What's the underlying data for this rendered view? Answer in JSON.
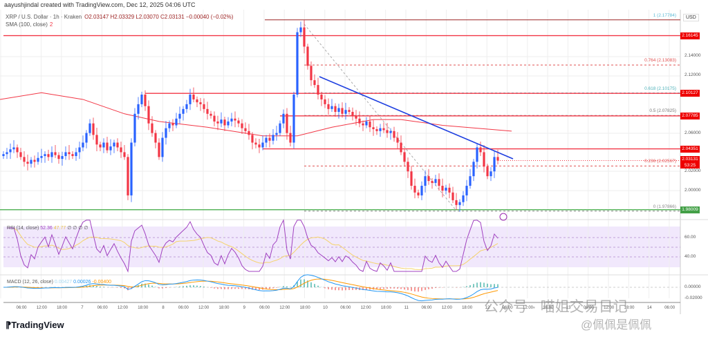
{
  "header": {
    "credit": "aayushjindal created with TradingView.com, Dec 12, 2025 04:06 UTC",
    "symbol": "XRP / U.S. Dollar · 1h · Kraken",
    "ohlc": "O2.03147  H2.03329  L2.03070  C2.03131  −0.00040 (−0.02%)",
    "sma_label": "SMA (100, close)",
    "sma_value": "2"
  },
  "axis": {
    "currency": "USD",
    "price_ticks": [
      "2.14000",
      "2.12000",
      "2.06000",
      "2.02000",
      "2.00000"
    ],
    "rsi_ticks": [
      "60.00",
      "40.00"
    ],
    "macd_ticks": [
      "0.00000",
      "-0.02000"
    ],
    "time_ticks": [
      "06:00",
      "12:00",
      "18:00",
      "7",
      "06:00",
      "12:00",
      "18:00",
      "8",
      "06:00",
      "12:00",
      "18:00",
      "9",
      "06:00",
      "12:00",
      "18:00",
      "10",
      "06:00",
      "12:00",
      "18:00",
      "11",
      "06:00",
      "12:00",
      "18:00",
      "12",
      "06:00",
      "12:00",
      "18:00",
      "13",
      "06:00",
      "12:00",
      "18:00",
      "14",
      "06:00"
    ]
  },
  "levels": [
    {
      "label": "2.16145",
      "price": 2.16145,
      "color": "#f23645"
    },
    {
      "label": "2.10127",
      "price": 2.10127,
      "color": "#f23645"
    },
    {
      "label": "2.07785",
      "price": 2.07785,
      "color": "#f23645"
    },
    {
      "label": "2.04351",
      "price": 2.04351,
      "color": "#f23645"
    },
    {
      "label": "1.98009",
      "price": 1.98009,
      "color": "#4caf50"
    }
  ],
  "current_price": {
    "label": "2.03131",
    "countdown": "53:25"
  },
  "fib": [
    {
      "label": "1 (2.17784)",
      "price": 2.17784,
      "color": "#5bbad5"
    },
    {
      "label": "0.764 (2.13083)",
      "price": 2.13083,
      "color": "#e05050"
    },
    {
      "label": "0.618 (2.10175)",
      "price": 2.10175,
      "color": "#4bb0b8"
    },
    {
      "label": "0.5 (2.07825)",
      "price": 2.07825,
      "color": "#777777"
    },
    {
      "label": "0.236 (2.02567)",
      "price": 2.02567,
      "color": "#e05050"
    },
    {
      "label": "0 (1.97866)",
      "price": 1.97866,
      "color": "#888888"
    }
  ],
  "rsi": {
    "label": "RSI (14, close)",
    "value": "52.36",
    "ma": "47.77",
    "extra": "∅ ∅ ∅ ∅"
  },
  "macd": {
    "label": "MACD (12, 26, close)",
    "hist": "0.00427",
    "macd": "0.00026",
    "signal": "-0.00400"
  },
  "branding": {
    "logo": "TradingView",
    "watermark": "公众号 · 喵姐交易日记",
    "watermark2": "@佩佩是佩佩"
  },
  "colors": {
    "up": "#2962ff",
    "down": "#f23645",
    "sma": "#f23645",
    "trendline": "#1e3fe0",
    "rsi": "#a040c0",
    "rsi_ma": "#f5d36b",
    "macd": "#2196f3",
    "signal": "#ff9800"
  },
  "chart_data": {
    "type": "candlestick",
    "interval": "1h",
    "closes": [
      2.038,
      2.04,
      2.043,
      2.045,
      2.04,
      2.035,
      2.03,
      2.028,
      2.032,
      2.03,
      2.034,
      2.036,
      2.038,
      2.035,
      2.04,
      2.037,
      2.033,
      2.036,
      2.04,
      2.038,
      2.036,
      2.04,
      2.045,
      2.05,
      2.06,
      2.07,
      2.058,
      2.048,
      2.045,
      2.05,
      2.042,
      2.046,
      2.05,
      2.045,
      2.04,
      2.035,
      1.995,
      2.05,
      2.08,
      2.09,
      2.1,
      2.088,
      2.07,
      2.06,
      2.05,
      2.035,
      2.055,
      2.065,
      2.07,
      2.068,
      2.075,
      2.08,
      2.085,
      2.09,
      2.1,
      2.095,
      2.092,
      2.09,
      2.085,
      2.08,
      2.078,
      2.072,
      2.07,
      2.074,
      2.068,
      2.072,
      2.075,
      2.073,
      2.07,
      2.065,
      2.062,
      2.058,
      2.05,
      2.048,
      2.045,
      2.05,
      2.055,
      2.052,
      2.058,
      2.06,
      2.07,
      2.08,
      2.06,
      2.05,
      2.1,
      2.165,
      2.17,
      2.15,
      2.13,
      2.115,
      2.11,
      2.1,
      2.095,
      2.09,
      2.085,
      2.088,
      2.082,
      2.086,
      2.08,
      2.084,
      2.082,
      2.078,
      2.075,
      2.07,
      2.068,
      2.072,
      2.066,
      2.064,
      2.062,
      2.065,
      2.063,
      2.06,
      2.062,
      2.055,
      2.05,
      2.04,
      2.03,
      2.02,
      2.005,
      1.998,
      1.995,
      2.005,
      2.015,
      2.01,
      2.008,
      2.012,
      2.005,
      2.0,
      2.003,
      1.998,
      1.99,
      1.985,
      1.988,
      1.995,
      2.005,
      2.015,
      2.03,
      2.045,
      2.04,
      2.025,
      2.015,
      2.02,
      2.035,
      2.03131
    ],
    "sma100": [
      [
        0,
        2.095
      ],
      [
        60,
        2.102
      ],
      [
        120,
        2.095
      ],
      [
        180,
        2.08
      ],
      [
        230,
        2.072
      ],
      [
        300,
        2.066
      ],
      [
        380,
        2.057
      ],
      [
        430,
        2.057
      ],
      [
        480,
        2.066
      ],
      [
        540,
        2.074
      ],
      [
        580,
        2.074
      ],
      [
        640,
        2.068
      ],
      [
        740,
        2.062
      ]
    ],
    "trendline": [
      [
        0,
        2.118
      ],
      [
        56,
        2.032
      ]
    ],
    "ylim": [
      1.97,
      2.185
    ]
  }
}
